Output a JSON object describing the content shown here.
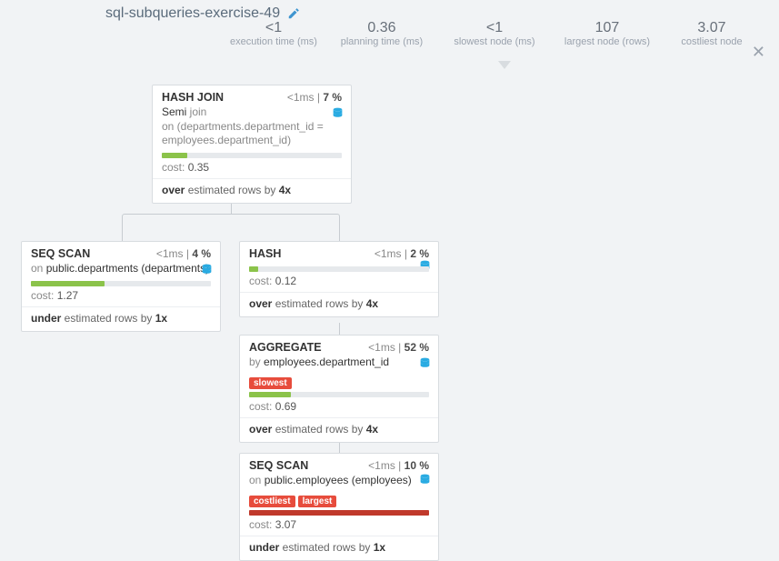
{
  "title": "sql-subqueries-exercise-49",
  "metrics": {
    "exec_val": "<1",
    "exec_lbl": "execution time (ms)",
    "plan_val": "0.36",
    "plan_lbl": "planning time (ms)",
    "slow_val": "<1",
    "slow_lbl": "slowest node (ms)",
    "large_val": "107",
    "large_lbl": "largest node (rows)",
    "cost_val": "3.07",
    "cost_lbl": "costliest node"
  },
  "nodes": {
    "hashjoin": {
      "title": "HASH JOIN",
      "time": "<1ms",
      "pct": "7 %",
      "sub_kw1": "Semi",
      "sub_rest1": " join",
      "sub_line2": "on (departments.department_id = employees.department_id)",
      "cost_lbl": "cost:",
      "cost_val": "0.35",
      "est_pre": "over",
      "est_mid": " estimated rows by ",
      "est_factor": "4x",
      "bar_pct": 14
    },
    "seqscan_dept": {
      "title": "SEQ SCAN",
      "time": "<1ms",
      "pct": "4 %",
      "sub_pre": "on ",
      "sub_val": "public.departments (departments)",
      "cost_lbl": "cost:",
      "cost_val": "1.27",
      "est_pre": "under",
      "est_mid": " estimated rows by ",
      "est_factor": "1x",
      "bar_pct": 41
    },
    "hash": {
      "title": "HASH",
      "time": "<1ms",
      "pct": "2 %",
      "cost_lbl": "cost:",
      "cost_val": "0.12",
      "est_pre": "over",
      "est_mid": " estimated rows by ",
      "est_factor": "4x",
      "bar_pct": 5
    },
    "aggregate": {
      "title": "AGGREGATE",
      "time": "<1ms",
      "pct": "52 %",
      "sub_pre": "by ",
      "sub_val": "employees.department_id",
      "tag1": "slowest",
      "cost_lbl": "cost:",
      "cost_val": "0.69",
      "est_pre": "over",
      "est_mid": " estimated rows by ",
      "est_factor": "4x",
      "bar_pct": 23
    },
    "seqscan_emp": {
      "title": "SEQ SCAN",
      "time": "<1ms",
      "pct": "10 %",
      "sub_pre": "on ",
      "sub_val": "public.employees (employees)",
      "tag1": "costliest",
      "tag2": "largest",
      "cost_lbl": "cost:",
      "cost_val": "3.07",
      "est_pre": "under",
      "est_mid": " estimated rows by ",
      "est_factor": "1x",
      "bar_pct": 100
    }
  }
}
